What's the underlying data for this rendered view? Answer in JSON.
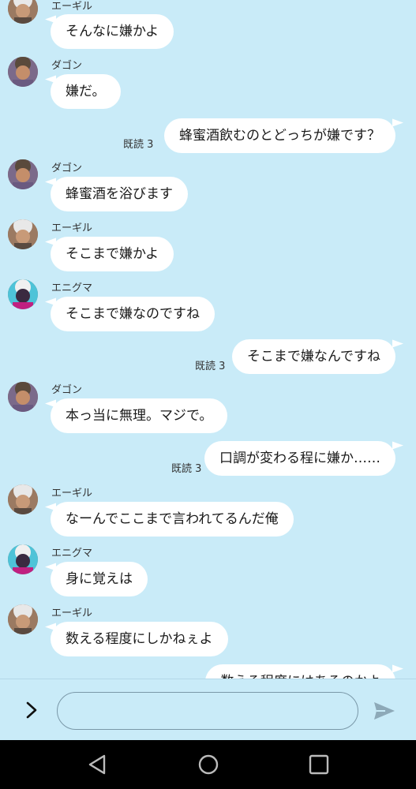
{
  "colors": {
    "background": "#c9ebf8",
    "bubble": "#ffffff",
    "nav_bar": "#000000"
  },
  "messages": [
    {
      "type": "in",
      "sender": "エーギル",
      "avatar": "aegir-avatar",
      "text": "そんなに嫌かよ"
    },
    {
      "type": "in",
      "sender": "ダゴン",
      "avatar": "dagon-avatar",
      "text": "嫌だ。"
    },
    {
      "type": "out",
      "read": "既読 3",
      "text": "蜂蜜酒飲むのとどっちが嫌です？"
    },
    {
      "type": "in",
      "sender": "ダゴン",
      "avatar": "dagon-avatar",
      "text": "蜂蜜酒を浴びます"
    },
    {
      "type": "in",
      "sender": "エーギル",
      "avatar": "aegir-avatar",
      "text": "そこまで嫌かよ"
    },
    {
      "type": "in",
      "sender": "エニグマ",
      "avatar": "enigma-avatar",
      "text": "そこまで嫌なのですね"
    },
    {
      "type": "out",
      "read": "既読 3",
      "text": "そこまで嫌なんですね"
    },
    {
      "type": "in",
      "sender": "ダゴン",
      "avatar": "dagon-avatar",
      "text": "本っ当に無理。マジで。"
    },
    {
      "type": "out",
      "read": "既読 3",
      "text": "口調が変わる程に嫌か……"
    },
    {
      "type": "in",
      "sender": "エーギル",
      "avatar": "aegir-avatar",
      "text": "なーんでここまで言われてるんだ俺"
    },
    {
      "type": "in",
      "sender": "エニグマ",
      "avatar": "enigma-avatar",
      "text": "身に覚えは"
    },
    {
      "type": "in",
      "sender": "エーギル",
      "avatar": "aegir-avatar",
      "text": "数える程度にしかねぇよ"
    },
    {
      "type": "out",
      "text": "数える程度にはあるのかよ"
    }
  ],
  "input_bar": {
    "expand_icon": "chevron-right-icon",
    "message_value": "",
    "send_icon": "send-icon"
  },
  "nav_bar": {
    "back_icon": "back-triangle-icon",
    "home_icon": "home-circle-icon",
    "recents_icon": "recents-square-icon"
  }
}
